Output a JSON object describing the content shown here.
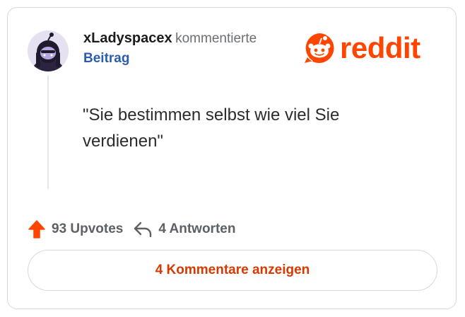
{
  "comment": {
    "username": "xLadyspacex",
    "action_text": "kommentierte",
    "post_link_label": "Beitrag",
    "body": "\"Sie bestimmen selbst wie viel Sie verdienen\""
  },
  "brand": {
    "logo_text": "reddit",
    "logo_icon": "reddit-snoo-icon",
    "color": "#ff4500"
  },
  "actions": {
    "upvotes_label": "93 Upvotes",
    "upvote_icon": "upvote-arrow-icon",
    "replies_label": "4 Antworten",
    "reply_icon": "reply-arrow-icon"
  },
  "footer": {
    "view_comments_label": "4 Kommentare anzeigen"
  },
  "colors": {
    "link": "#2a5db0",
    "accent": "#ff4500",
    "button_text": "#d93900",
    "muted": "#5c6166"
  }
}
